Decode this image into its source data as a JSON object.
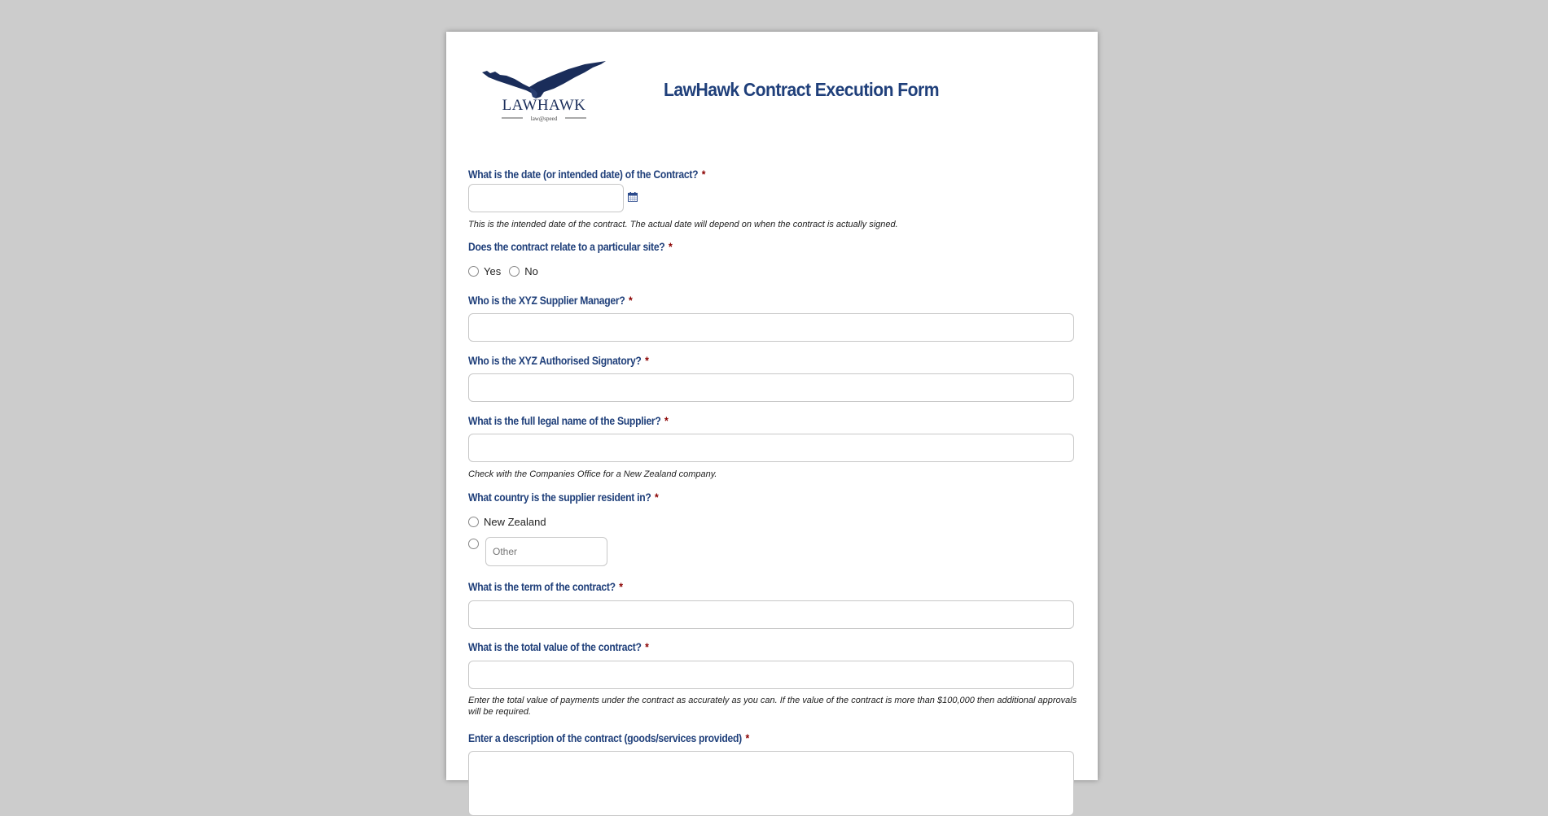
{
  "header": {
    "logo_text": "LAWHAWK",
    "logo_tagline": "law@speed",
    "title": "LawHawk Contract Execution Form"
  },
  "colors": {
    "label": "#1f3f7a",
    "required": "#8b0000",
    "background": "#cccccc"
  },
  "required_marker": "*",
  "questions": {
    "date": {
      "label": "What is the date (or intended date) of the Contract?",
      "value": "",
      "icon": "calendar-icon",
      "help": "This is the intended date of the contract. The actual date will depend on when the contract is actually signed."
    },
    "site": {
      "label": "Does the contract relate to a particular site?",
      "options": [
        "Yes",
        "No"
      ]
    },
    "supplier_manager": {
      "label": "Who is the XYZ Supplier Manager?",
      "value": ""
    },
    "authorised_signatory": {
      "label": "Who is the XYZ Authorised Signatory?",
      "value": ""
    },
    "supplier_name": {
      "label": "What is the full legal name of the Supplier?",
      "value": "",
      "help": "Check with the Companies Office for a New Zealand company."
    },
    "country": {
      "label": "What country is the supplier resident in?",
      "options": [
        "New Zealand"
      ],
      "other_placeholder": "Other"
    },
    "term": {
      "label": "What is the term of the contract?",
      "value": ""
    },
    "value": {
      "label": "What is the total value of the contract?",
      "value": "",
      "help": "Enter the total value of payments under the contract as accurately as you can. If the value of the contract is more than $100,000 then additional approvals will be required."
    },
    "description": {
      "label": "Enter a description of the contract (goods/services provided)"
    }
  }
}
